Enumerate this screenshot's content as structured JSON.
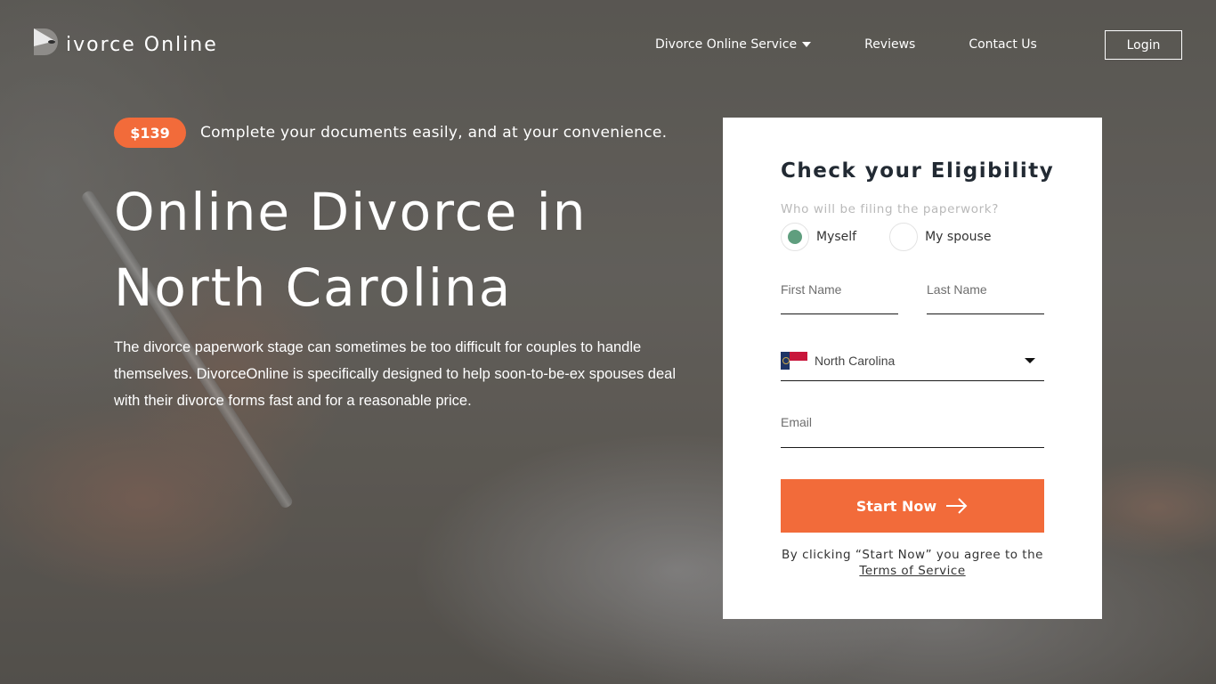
{
  "brand": {
    "logo_text": "ivorce Online",
    "logo_icon": "d-letter-logo-icon"
  },
  "nav": {
    "items": [
      {
        "label": "Divorce Online Service",
        "has_dropdown": true
      },
      {
        "label": "Reviews"
      },
      {
        "label": "Contact Us"
      }
    ],
    "login_label": "Login"
  },
  "hero": {
    "price": "$139",
    "tagline": "Complete your documents easily, and at your convenience.",
    "title_line1": "Online Divorce in",
    "title_line2": "North Carolina",
    "description": "The divorce paperwork stage can sometimes be too difficult for couples to handle themselves. DivorceOnline is specifically designed to help soon-to-be-ex spouses deal with their divorce forms fast and for a reasonable price."
  },
  "form": {
    "title": "Check your Eligibility",
    "question": "Who will be filing the paperwork?",
    "options": [
      {
        "label": "Myself",
        "selected": true
      },
      {
        "label": "My spouse",
        "selected": false
      }
    ],
    "first_name": {
      "value": "",
      "placeholder": "First Name"
    },
    "last_name": {
      "value": "",
      "placeholder": "Last Name"
    },
    "state": {
      "selected": "North Carolina",
      "icon": "north-carolina-flag-icon"
    },
    "email": {
      "value": "",
      "placeholder": "Email"
    },
    "submit_label": "Start Now",
    "consent_text": "By clicking “Start Now” you agree to the",
    "terms_label": "Terms of Service"
  },
  "colors": {
    "accent": "#f26b3a",
    "radio_selected": "#5f9e7e",
    "card_title": "#222a33"
  }
}
